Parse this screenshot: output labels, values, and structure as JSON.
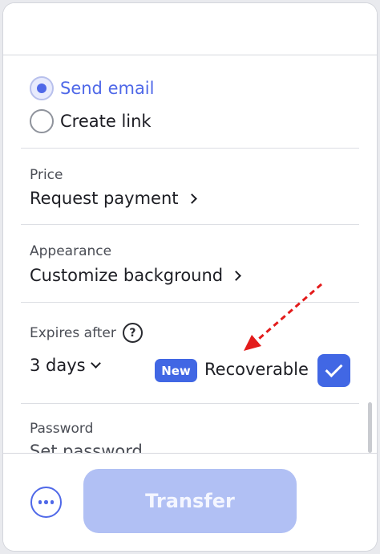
{
  "delivery": {
    "options": [
      {
        "label": "Send email",
        "selected": true
      },
      {
        "label": "Create link",
        "selected": false
      }
    ]
  },
  "price": {
    "label": "Price",
    "action": "Request payment"
  },
  "appearance": {
    "label": "Appearance",
    "action": "Customize background"
  },
  "expires": {
    "label": "Expires after",
    "help_icon": "question-circle-icon",
    "value": "3 days",
    "badge": "New",
    "recoverable_label": "Recoverable",
    "recoverable_checked": true
  },
  "password": {
    "label": "Password",
    "placeholder": "Set password"
  },
  "footer": {
    "more_icon": "more-horizontal-icon",
    "transfer_label": "Transfer",
    "transfer_enabled": false
  },
  "colors": {
    "accent": "#4167e4",
    "selected_text": "#4f68e8",
    "disabled_button": "#b1c0f4",
    "annotation_arrow": "#e31b1b"
  }
}
